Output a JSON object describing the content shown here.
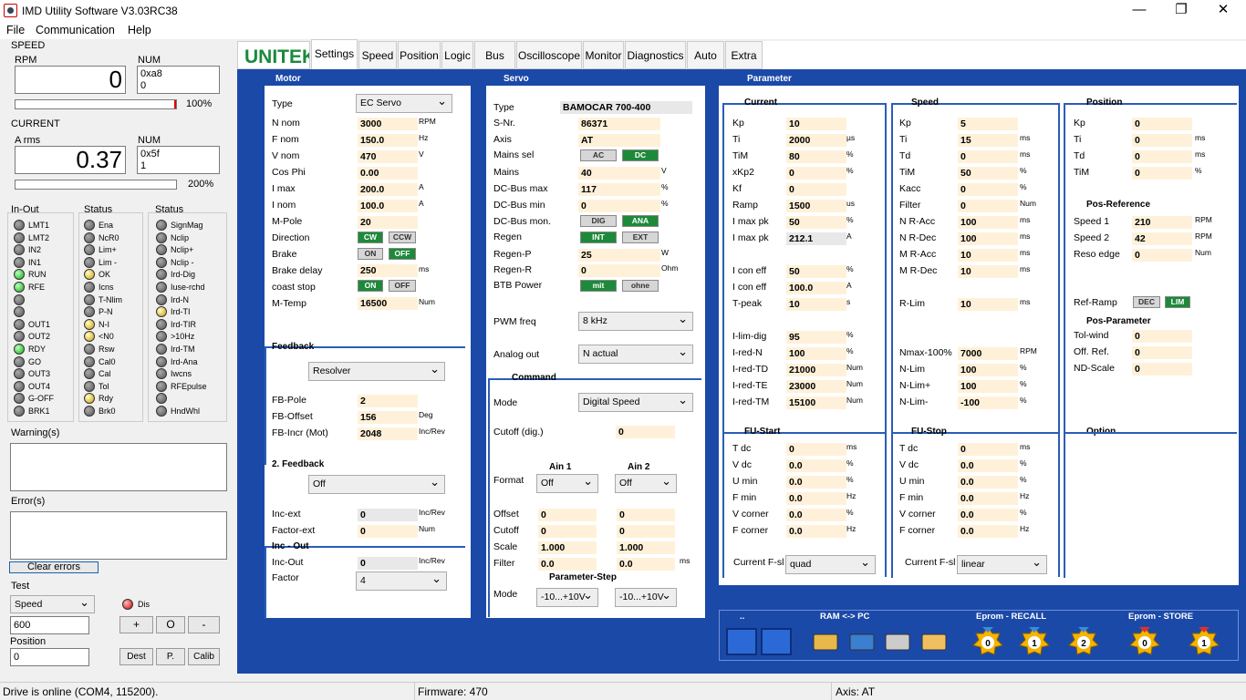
{
  "title": "IMD Utility Software V3.03RC38",
  "menu": [
    "File",
    "Communication",
    "Help"
  ],
  "speed": {
    "title": "SPEED",
    "rpm_label": "RPM",
    "rpm_value": "0",
    "num_label": "NUM",
    "num_hex": "0xa8",
    "num_dec": "0",
    "pct": "100%"
  },
  "current": {
    "title": "CURRENT",
    "arms_label": "A rms",
    "arms_value": "0.37",
    "num_label": "NUM",
    "num_hex": "0x5f",
    "num_dec": "1",
    "pct": "200%"
  },
  "inout": {
    "title": "In-Out",
    "items": [
      "LMT1",
      "LMT2",
      "IN2",
      "IN1",
      "RUN",
      "RFE",
      "",
      "",
      "OUT1",
      "OUT2",
      "RDY",
      "GO",
      "OUT3",
      "OUT4",
      "G-OFF",
      "BRK1"
    ],
    "colors": [
      "gray",
      "gray",
      "gray",
      "gray",
      "green",
      "green",
      "gray",
      "gray",
      "gray",
      "gray",
      "green",
      "gray",
      "gray",
      "gray",
      "gray",
      "gray"
    ]
  },
  "status1": {
    "title": "Status",
    "items": [
      "Ena",
      "NcR0",
      "Lim+",
      "Lim -",
      "OK",
      "Icns",
      "T-Nlim",
      "P-N",
      "N-I",
      "<N0",
      "Rsw",
      "Cal0",
      "Cal",
      "Tol",
      "Rdy",
      "Brk0"
    ],
    "colors": [
      "gray",
      "gray",
      "gray",
      "gray",
      "yellow",
      "gray",
      "gray",
      "gray",
      "yellow",
      "yellow",
      "gray",
      "gray",
      "gray",
      "gray",
      "yellow",
      "gray"
    ]
  },
  "status2": {
    "title": "Status",
    "items": [
      "SignMag",
      "Nclip",
      "Nclip+",
      "Nclip -",
      "Ird-Dig",
      "Iuse-rchd",
      "Ird-N",
      "Ird-TI",
      "Ird-TIR",
      ">10Hz",
      "Ird-TM",
      "Ird-Ana",
      "Iwcns",
      "RFEpulse",
      "",
      "HndWhl"
    ],
    "colors": [
      "gray",
      "gray",
      "gray",
      "gray",
      "gray",
      "gray",
      "gray",
      "yellow",
      "gray",
      "gray",
      "gray",
      "gray",
      "gray",
      "gray",
      "gray",
      "gray"
    ]
  },
  "warnings": {
    "title": "Warning(s)"
  },
  "errors": {
    "title": "Error(s)",
    "clear": "Clear errors"
  },
  "test": {
    "title": "Test",
    "mode": "Speed",
    "value": "600",
    "dis": "Dis",
    "plus": "+",
    "zero": "O",
    "minus": "-",
    "position_label": "Position",
    "position": "0",
    "dest": "Dest",
    "p": "P.",
    "calib": "Calib"
  },
  "logo": "UNITEK",
  "tabs": [
    "Settings",
    "Speed",
    "Position",
    "Logic",
    "Bus",
    "Oscilloscope",
    "Monitor",
    "Diagnostics",
    "Auto",
    "Extra"
  ],
  "motor": {
    "title": "Motor",
    "type_label": "Type",
    "type": "EC Servo",
    "rows": [
      [
        "N nom",
        "3000",
        "RPM"
      ],
      [
        "F nom",
        "150.0",
        "Hz"
      ],
      [
        "V nom",
        "470",
        "V"
      ],
      [
        "Cos Phi",
        "0.00",
        ""
      ],
      [
        "I max",
        "200.0",
        "A"
      ],
      [
        "I nom",
        "100.0",
        "A"
      ],
      [
        "M-Pole",
        "20",
        ""
      ]
    ],
    "direction_label": "Direction",
    "dir_cw": "CW",
    "dir_ccw": "CCW",
    "brake_label": "Brake",
    "brake_on": "ON",
    "brake_off": "OFF",
    "brake_delay_label": "Brake delay",
    "brake_delay": "250",
    "brake_delay_unit": "ms",
    "coast_label": "coast stop",
    "coast_on": "ON",
    "coast_off": "OFF",
    "mtemp_label": "M-Temp",
    "mtemp": "16500",
    "mtemp_unit": "Num",
    "feedback_title": "Feedback",
    "feedback": "Resolver",
    "fb_rows": [
      [
        "FB-Pole",
        "2",
        ""
      ],
      [
        "FB-Offset",
        "156",
        "Deg"
      ],
      [
        "FB-Incr (Mot)",
        "2048",
        "Inc/Rev"
      ]
    ],
    "feedback2_title": "2. Feedback",
    "feedback2": "Off",
    "inc_rows": [
      [
        "Inc-ext",
        "0",
        "Inc/Rev"
      ],
      [
        "Factor-ext",
        "0",
        "Num"
      ]
    ],
    "incout_title": "Inc - Out",
    "incout_label": "Inc-Out",
    "incout": "0",
    "incout_unit": "Inc/Rev",
    "factor_label": "Factor",
    "factor": "4"
  },
  "servo": {
    "title": "Servo",
    "type_label": "Type",
    "type": "BAMOCAR 700-400",
    "snr_label": "S-Nr.",
    "snr": "86371",
    "axis_label": "Axis",
    "axis": "AT",
    "mains_sel_label": "Mains sel",
    "ac": "AC",
    "dc": "DC",
    "mains_label": "Mains",
    "mains": "40",
    "mains_unit": "V",
    "dcmax_label": "DC-Bus max",
    "dcmax": "117",
    "dcmin_label": "DC-Bus min",
    "dcmin": "0",
    "pct": "%",
    "dcmon_label": "DC-Bus mon.",
    "dig": "DIG",
    "ana": "ANA",
    "regen_label": "Regen",
    "int": "INT",
    "ext": "EXT",
    "regenp_label": "Regen-P",
    "regenp": "25",
    "regenp_unit": "W",
    "regenr_label": "Regen-R",
    "regenr": "0",
    "regenr_unit": "Ohm",
    "btb_label": "BTB Power",
    "mit": "mit",
    "ohne": "ohne",
    "pwm_label": "PWM freq",
    "pwm": "8 kHz",
    "analog_label": "Analog out",
    "analog": "N actual",
    "command_title": "Command",
    "mode_label": "Mode",
    "mode": "Digital Speed",
    "cutoff_label": "Cutoff (dig.)",
    "cutoff": "0",
    "ain1": "Ain 1",
    "ain2": "Ain 2",
    "format_label": "Format",
    "format1": "Off",
    "format2": "Off",
    "arows": [
      [
        "Offset",
        "0",
        "0"
      ],
      [
        "Cutoff",
        "0",
        "0"
      ],
      [
        "Scale",
        "1.000",
        "1.000"
      ],
      [
        "Filter",
        "0.0",
        "0.0"
      ]
    ],
    "filter_unit": "ms",
    "pstep_title": "Parameter-Step",
    "pmode_label": "Mode",
    "pmode1": "-10...+10V",
    "pmode2": "-10...+10V"
  },
  "param": {
    "title": "Parameter",
    "current": {
      "title": "Current",
      "rows": [
        [
          "Kp",
          "10",
          ""
        ],
        [
          "Ti",
          "2000",
          "µs"
        ],
        [
          "TiM",
          "80",
          "%"
        ],
        [
          "xKp2",
          "0",
          "%"
        ],
        [
          "Kf",
          "0",
          ""
        ],
        [
          "Ramp",
          "1500",
          "us"
        ],
        [
          "I max pk",
          "50",
          "%"
        ],
        [
          "I max pk",
          "212.1",
          "A"
        ],
        [
          "",
          "",
          ""
        ],
        [
          "I con eff",
          "50",
          "%"
        ],
        [
          "I con eff",
          "100.0",
          "A"
        ],
        [
          "T-peak",
          "10",
          "s"
        ],
        [
          "",
          "",
          ""
        ],
        [
          "I-lim-dig",
          "95",
          "%"
        ],
        [
          "I-red-N",
          "100",
          "%"
        ],
        [
          "I-red-TD",
          "21000",
          "Num"
        ],
        [
          "I-red-TE",
          "23000",
          "Num"
        ],
        [
          "I-red-TM",
          "15100",
          "Num"
        ]
      ]
    },
    "speed": {
      "title": "Speed",
      "rows": [
        [
          "Kp",
          "5",
          ""
        ],
        [
          "Ti",
          "15",
          "ms"
        ],
        [
          "Td",
          "0",
          "ms"
        ],
        [
          "TiM",
          "50",
          "%"
        ],
        [
          "Kacc",
          "0",
          "%"
        ],
        [
          "Filter",
          "0",
          "Num"
        ],
        [
          "N R-Acc",
          "100",
          "ms"
        ],
        [
          "N R-Dec",
          "100",
          "ms"
        ],
        [
          "M R-Acc",
          "10",
          "ms"
        ],
        [
          "M R-Dec",
          "10",
          "ms"
        ],
        [
          "",
          "",
          ""
        ],
        [
          "R-Lim",
          "10",
          "ms"
        ],
        [
          "",
          "",
          ""
        ],
        [
          "",
          "",
          ""
        ],
        [
          "Nmax-100%",
          "7000",
          "RPM"
        ],
        [
          "N-Lim",
          "100",
          "%"
        ],
        [
          "N-Lim+",
          "100",
          "%"
        ],
        [
          "N-Lim-",
          "-100",
          "%"
        ]
      ]
    },
    "position": {
      "title": "Position",
      "rows": [
        [
          "Kp",
          "0",
          ""
        ],
        [
          "Ti",
          "0",
          "ms"
        ],
        [
          "Td",
          "0",
          "ms"
        ],
        [
          "TiM",
          "0",
          "%"
        ]
      ],
      "ref_title": "Pos-Reference",
      "ref_rows": [
        [
          "Speed 1",
          "210",
          "RPM"
        ],
        [
          "Speed 2",
          "42",
          "RPM"
        ],
        [
          "Reso edge",
          "0",
          "Num"
        ]
      ],
      "ramp_label": "Ref-Ramp",
      "dec": "DEC",
      "lim": "LIM",
      "pp_title": "Pos-Parameter",
      "pp_rows": [
        [
          "Tol-wind",
          "0"
        ],
        [
          "Off. Ref.",
          "0"
        ],
        [
          "ND-Scale",
          "0"
        ]
      ],
      "option_title": "Option"
    },
    "fustart": {
      "title": "FU-Start",
      "rows": [
        [
          "T dc",
          "0",
          "ms"
        ],
        [
          "V dc",
          "0.0",
          "%"
        ],
        [
          "U min",
          "0.0",
          "%"
        ],
        [
          "F min",
          "0.0",
          "Hz"
        ],
        [
          "V corner",
          "0.0",
          "%"
        ],
        [
          "F corner",
          "0.0",
          "Hz"
        ]
      ],
      "fsl_label": "Current F-sl",
      "fsl": "quad"
    },
    "fustop": {
      "title": "FU-Stop",
      "rows": [
        [
          "T dc",
          "0",
          "ms"
        ],
        [
          "V dc",
          "0.0",
          "%"
        ],
        [
          "U min",
          "0.0",
          "%"
        ],
        [
          "F min",
          "0.0",
          "Hz"
        ],
        [
          "V corner",
          "0.0",
          "%"
        ],
        [
          "F corner",
          "0.0",
          "Hz"
        ]
      ],
      "fsl_label": "Current F-sl",
      "fsl": "linear"
    }
  },
  "toolbar": {
    "dots": "..",
    "ram": "RAM <-> PC",
    "recall": "Eprom - RECALL",
    "store": "Eprom - STORE",
    "r0": "0",
    "r1": "1",
    "r2": "2",
    "s0": "0",
    "s1": "1"
  },
  "status": {
    "online": "Drive is online (COM4, 115200).",
    "firmware": "Firmware: 470",
    "axis": "Axis: AT"
  }
}
